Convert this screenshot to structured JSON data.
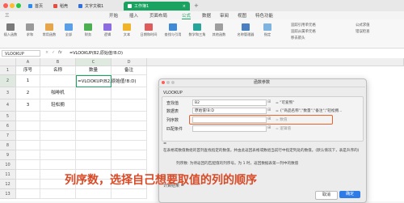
{
  "window": {
    "tabs": [
      {
        "label": "首页"
      },
      {
        "label": "稻壳"
      },
      {
        "label": "文字文稿1"
      },
      {
        "label": "工作簿1"
      }
    ],
    "add_tab": "+"
  },
  "menu": [
    "三",
    "开始",
    "插入",
    "页面布局",
    "公式",
    "数据",
    "审阅",
    "视图",
    "特色功能"
  ],
  "ribbon": {
    "buttons": [
      {
        "label": "插入函数"
      },
      {
        "label": "求和"
      },
      {
        "label": "常用函数"
      },
      {
        "label": "全部"
      },
      {
        "label": "财务"
      },
      {
        "label": "逻辑"
      },
      {
        "label": "文本"
      },
      {
        "label": "日期和时间"
      },
      {
        "label": "查找与引用"
      },
      {
        "label": "数学和三角"
      },
      {
        "label": "其他函数"
      },
      {
        "label": "名称管理器"
      },
      {
        "label": "指定"
      }
    ],
    "side_items": [
      "追踪引用单元格",
      "追踪从属单元格",
      "移去箭头"
    ],
    "right_items": [
      "公式求值",
      "错误检查"
    ]
  },
  "formula_bar": {
    "name_box": "VLOOKUP",
    "fx": "fx",
    "formula": "=VLOOKUP(B2,原始值!B:D)"
  },
  "sheet": {
    "columns": [
      "A",
      "B",
      "C",
      "D"
    ],
    "rows": [
      {
        "num": "1",
        "cells": [
          "序号",
          "名称",
          "数量",
          "备注"
        ]
      },
      {
        "num": "2",
        "cells": [
          "1",
          "",
          "=VLOOKUP(B2,原始值!B:D)",
          ""
        ]
      },
      {
        "num": "3",
        "cells": [
          "2",
          "咖啡机",
          "",
          ""
        ]
      },
      {
        "num": "4",
        "cells": [
          "3",
          "轻松拥",
          "",
          ""
        ]
      },
      {
        "num": "5",
        "cells": [
          "",
          "",
          "",
          ""
        ]
      },
      {
        "num": "6",
        "cells": [
          "",
          "",
          "",
          ""
        ]
      },
      {
        "num": "7",
        "cells": [
          "",
          "",
          "",
          ""
        ]
      },
      {
        "num": "8",
        "cells": [
          "",
          "",
          "",
          ""
        ]
      },
      {
        "num": "9",
        "cells": [
          "",
          "",
          "",
          ""
        ]
      },
      {
        "num": "10",
        "cells": [
          "",
          "",
          "",
          ""
        ]
      },
      {
        "num": "11",
        "cells": [
          "",
          "",
          "",
          ""
        ]
      },
      {
        "num": "12",
        "cells": [
          "",
          "",
          "",
          ""
        ]
      },
      {
        "num": "13",
        "cells": [
          "",
          "",
          "",
          ""
        ]
      }
    ]
  },
  "dialog": {
    "title": "函数参数",
    "func": "VLOOKUP",
    "fields": [
      {
        "label": "查找值",
        "value": "B2",
        "result": "= \"可爱熊\""
      },
      {
        "label": "数据表",
        "value": "原始值!B:D",
        "result": "= {\"商品名称\",\"数量\",\"备注\";\"轻松拥..."
      },
      {
        "label": "列序数",
        "value": "",
        "result": "= 数值"
      },
      {
        "label": "匹配条件",
        "value": "",
        "result": "= 逻辑值"
      }
    ],
    "equals": "=",
    "description": "在表格或数值数组的首列查找指定的数值，并由此返回表格或数组当前行中指定列处的数值。(默认情况下，表是升序的)",
    "param_desc": "列序数: 为待返回的匹配值的列序号。为 1 时，返回数据表第一列中的数值",
    "calc_label": "计算结果 =",
    "ok_label": "确定",
    "cancel_label": "取消"
  },
  "caption": "列序数，选择自己想要取值的列的顺序",
  "colors": {
    "accent_green": "#1aa260",
    "highlight_orange": "#e8622c",
    "caption_red": "#d94a26"
  }
}
